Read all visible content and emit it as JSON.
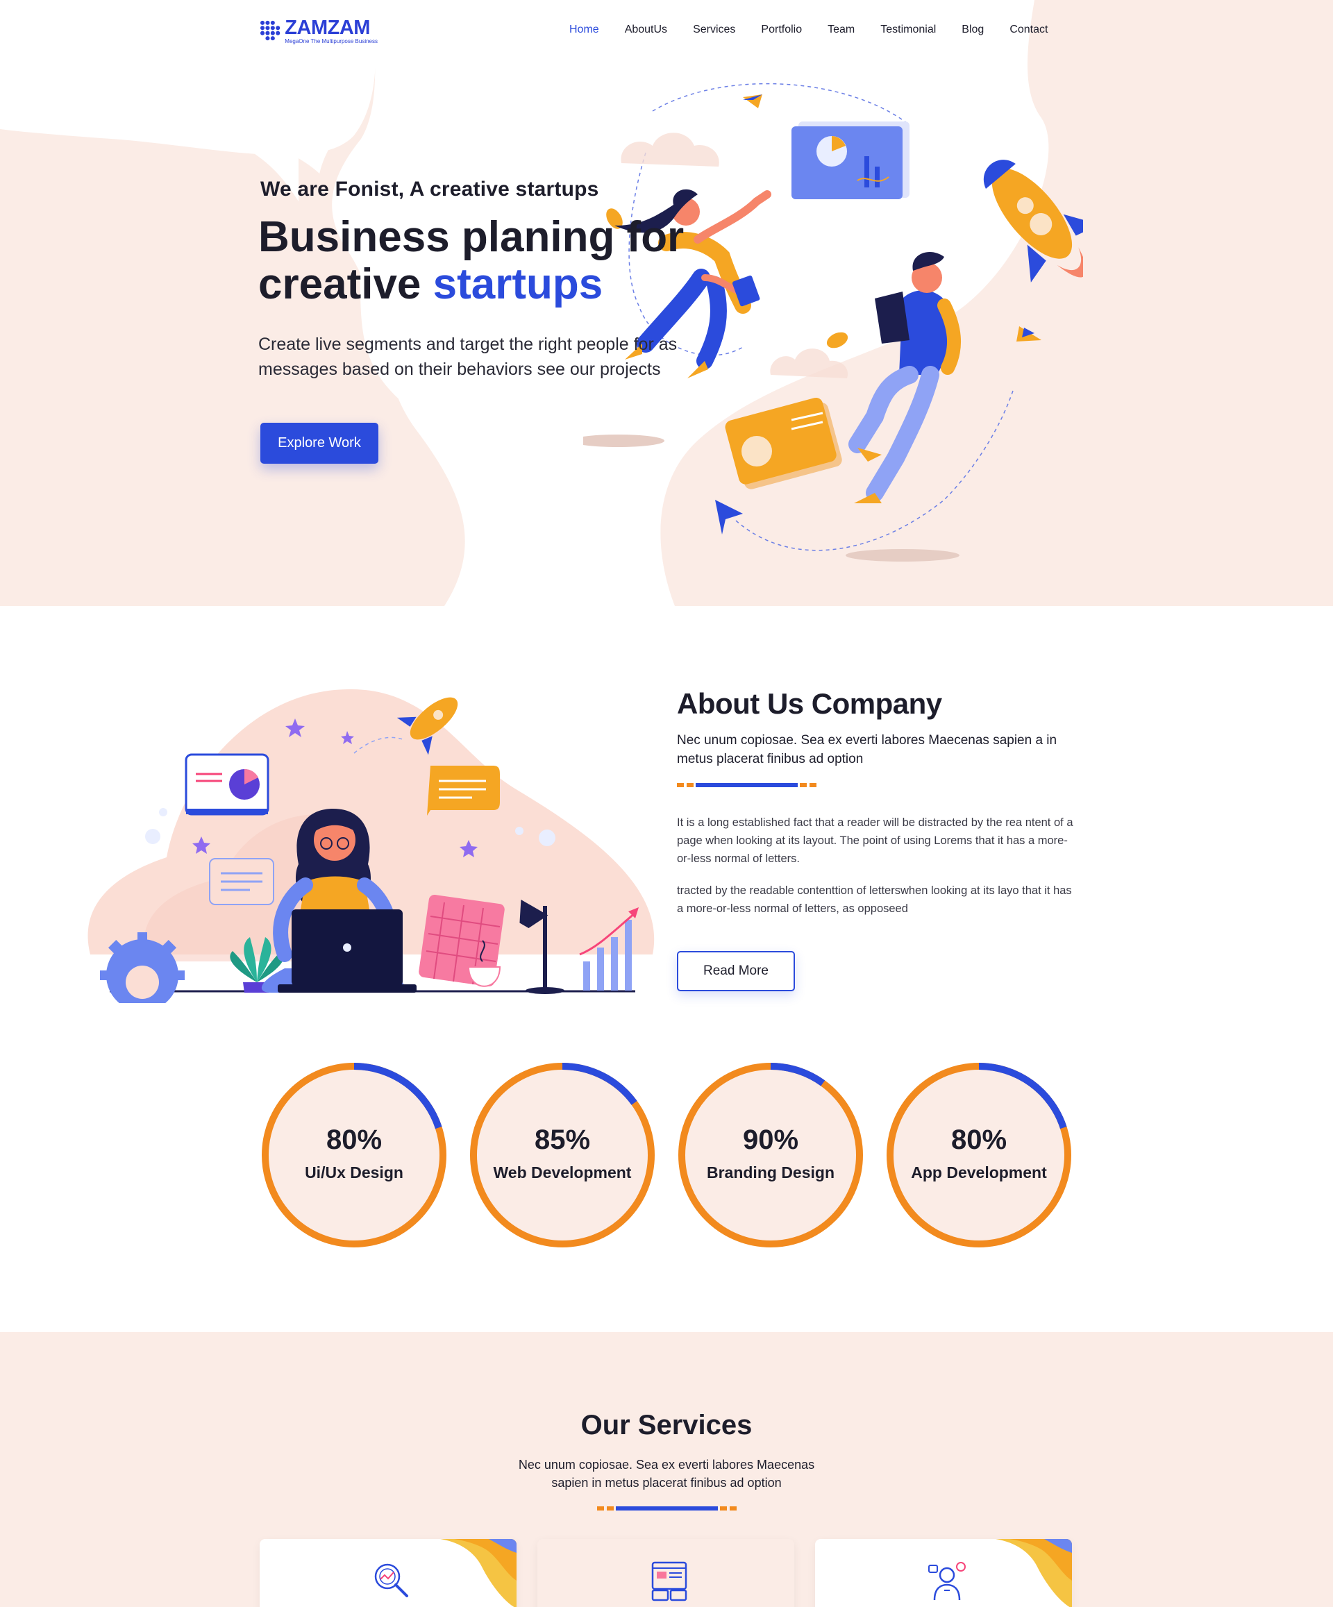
{
  "brand": {
    "name": "ZAMZAM",
    "tagline": "MegaOne The Multipurpose Business",
    "primary_color": "#2b4bdc",
    "accent_color": "#f28a1e",
    "background_tint": "#fbece6"
  },
  "nav": {
    "items": [
      {
        "label": "Home",
        "active": true
      },
      {
        "label": "AboutUs",
        "active": false
      },
      {
        "label": "Services",
        "active": false
      },
      {
        "label": "Portfolio",
        "active": false
      },
      {
        "label": "Team",
        "active": false
      },
      {
        "label": "Testimonial",
        "active": false
      },
      {
        "label": "Blog",
        "active": false
      },
      {
        "label": "Contact",
        "active": false
      }
    ]
  },
  "hero": {
    "subtitle": "We are Fonist, A creative startups",
    "title_line1": "Business planing for",
    "title_line2_plain": "creative ",
    "title_line2_accent": "startups",
    "description": "Create live segments and target the right people for as messages based on their behaviors see our projects",
    "cta_label": "Explore Work",
    "illustration": "team-startup-illustration"
  },
  "about": {
    "title": "About Us Company",
    "lead": "Nec unum copiosae. Sea ex everti labores Maecenas sapien a in metus placerat finibus ad option",
    "paragraph1": "It is a long established fact that a reader will be distracted by the rea ntent of a page when looking at its layout. The point of using Lorems that it has a more-or-less normal of letters.",
    "paragraph2": "tracted by the readable contenttion of letterswhen looking at its layo that it has a more-or-less normal of letters, as opposeed",
    "cta_label": "Read More",
    "illustration": "woman-working-laptop-illustration"
  },
  "skills": [
    {
      "value": "80%",
      "label": "Ui/Ux Design",
      "percent": 80
    },
    {
      "value": "85%",
      "label": "Web Development",
      "percent": 85
    },
    {
      "value": "90%",
      "label": "Branding Design",
      "percent": 90
    },
    {
      "value": "80%",
      "label": "App Development",
      "percent": 80
    }
  ],
  "services": {
    "title": "Our Services",
    "description": "Nec unum copiosae. Sea ex everti labores Maecenas sapien in metus placerat finibus ad option",
    "cards": [
      {
        "icon": "analytics-search-icon"
      },
      {
        "icon": "website-layout-icon"
      },
      {
        "icon": "team-person-icon"
      }
    ]
  }
}
